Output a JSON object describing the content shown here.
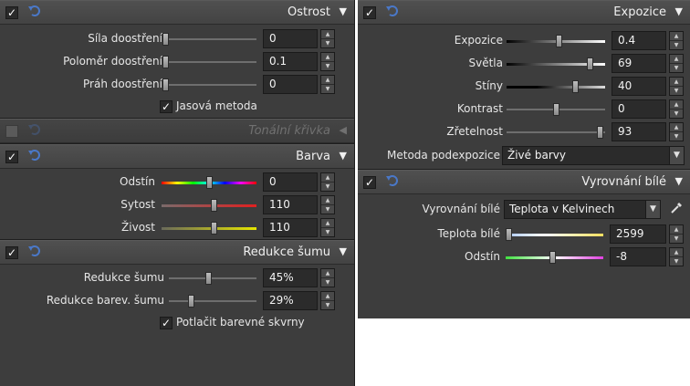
{
  "left": {
    "sharpen": {
      "title": "Ostrost",
      "enabled": true,
      "sliders": [
        {
          "label": "Síla doostření",
          "value": "0",
          "fraction": 0.0
        },
        {
          "label": "Poloměr doostření",
          "value": "0.1",
          "fraction": 0.0
        },
        {
          "label": "Práh doostření",
          "value": "0",
          "fraction": 0.0
        }
      ],
      "checkbox": {
        "label": "Jasová metoda",
        "checked": true
      }
    },
    "tone_curve": {
      "title": "Tonální křivka",
      "enabled": false
    },
    "color": {
      "title": "Barva",
      "enabled": true,
      "sliders": [
        {
          "label": "Odstín",
          "value": "0",
          "fraction": 0.5
        },
        {
          "label": "Sytost",
          "value": "110",
          "fraction": 0.55
        },
        {
          "label": "Živost",
          "value": "110",
          "fraction": 0.55
        }
      ]
    },
    "noise": {
      "title": "Redukce šumu",
      "enabled": true,
      "sliders": [
        {
          "label": "Redukce šumu",
          "value": "45%",
          "fraction": 0.45
        },
        {
          "label": "Redukce barev. šumu",
          "value": "29%",
          "fraction": 0.29
        }
      ],
      "checkbox": {
        "label": "Potlačit barevné skvrny",
        "checked": true
      }
    }
  },
  "right": {
    "exposure": {
      "title": "Expozice",
      "enabled": true,
      "sliders": [
        {
          "label": "Expozice",
          "value": "0.4",
          "fraction": 0.55
        },
        {
          "label": "Světla",
          "value": "69",
          "fraction": 0.84
        },
        {
          "label": "Stíny",
          "value": "40",
          "fraction": 0.7
        },
        {
          "label": "Kontrast",
          "value": "0",
          "fraction": 0.5
        },
        {
          "label": "Zřetelnost",
          "value": "93",
          "fraction": 0.97
        }
      ],
      "method": {
        "label": "Metoda podexpozice",
        "value": "Živé barvy"
      }
    },
    "white_balance": {
      "title": "Vyrovnání bílé",
      "enabled": true,
      "mode": {
        "label": "Vyrovnání bílé",
        "value": "Teplota v Kelvinech"
      },
      "sliders": [
        {
          "label": "Teplota bílé",
          "value": "2599",
          "fraction": 0.0
        },
        {
          "label": "Odstín",
          "value": "-8",
          "fraction": 0.46
        }
      ]
    }
  },
  "icons": {
    "checkbox_mark": "✓",
    "collapse_arrow": "▼",
    "expand_arrow": "◀",
    "spin_up": "▲",
    "spin_down": "▼"
  },
  "colors": {
    "panel_bg": "#3d3d3d",
    "header_bg": "#4a4a4a",
    "undo_icon": "#4a78c8"
  }
}
